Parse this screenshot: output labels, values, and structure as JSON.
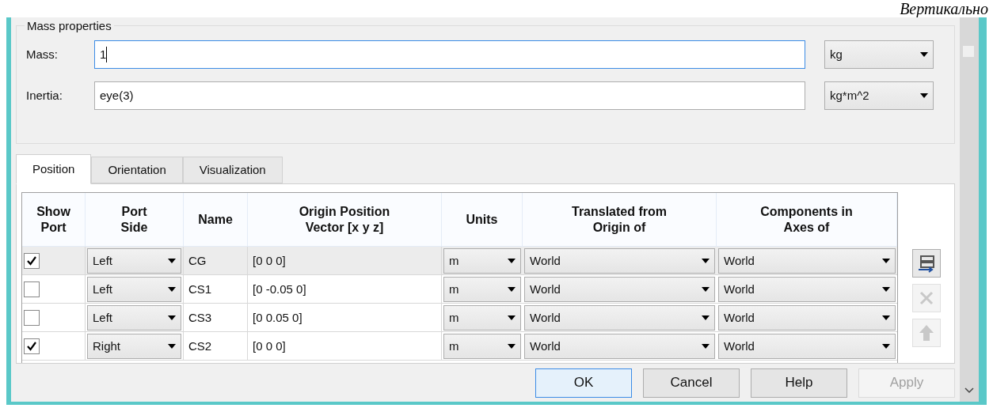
{
  "corner_text": "Вертикально",
  "mass_properties": {
    "title": "Mass properties",
    "fields": [
      {
        "label": "Mass:",
        "value": "1",
        "focused": true,
        "unit": "kg"
      },
      {
        "label": "Inertia:",
        "value": "eye(3)",
        "focused": false,
        "unit": "kg*m^2"
      }
    ]
  },
  "tabs": [
    {
      "label": "Position",
      "selected": true
    },
    {
      "label": "Orientation",
      "selected": false
    },
    {
      "label": "Visualization",
      "selected": false
    }
  ],
  "table": {
    "columns": [
      "Show\nPort",
      "Port\nSide",
      "Name",
      "Origin Position\nVector [x y z]",
      "Units",
      "Translated from\nOrigin of",
      "Components in\nAxes of"
    ],
    "rows": [
      {
        "show_port": true,
        "port_side": "Left",
        "name": "CG",
        "origin": "[0 0 0]",
        "units": "m",
        "translated_from": "World",
        "components_in": "World",
        "selected": true
      },
      {
        "show_port": false,
        "port_side": "Left",
        "name": "CS1",
        "origin": "[0 -0.05 0]",
        "units": "m",
        "translated_from": "World",
        "components_in": "World",
        "selected": false
      },
      {
        "show_port": false,
        "port_side": "Left",
        "name": "CS3",
        "origin": "[0 0.05 0]",
        "units": "m",
        "translated_from": "World",
        "components_in": "World",
        "selected": false
      },
      {
        "show_port": true,
        "port_side": "Right",
        "name": "CS2",
        "origin": "[0 0 0]",
        "units": "m",
        "translated_from": "World",
        "components_in": "World",
        "selected": false
      }
    ]
  },
  "side_buttons": [
    {
      "kind": "add",
      "disabled": false
    },
    {
      "kind": "delete",
      "disabled": true
    },
    {
      "kind": "up",
      "disabled": true
    }
  ],
  "buttons": [
    {
      "label": "OK",
      "default": true,
      "disabled": false
    },
    {
      "label": "Cancel",
      "default": false,
      "disabled": false
    },
    {
      "label": "Help",
      "default": false,
      "disabled": false
    },
    {
      "label": "Apply",
      "default": false,
      "disabled": true
    }
  ]
}
